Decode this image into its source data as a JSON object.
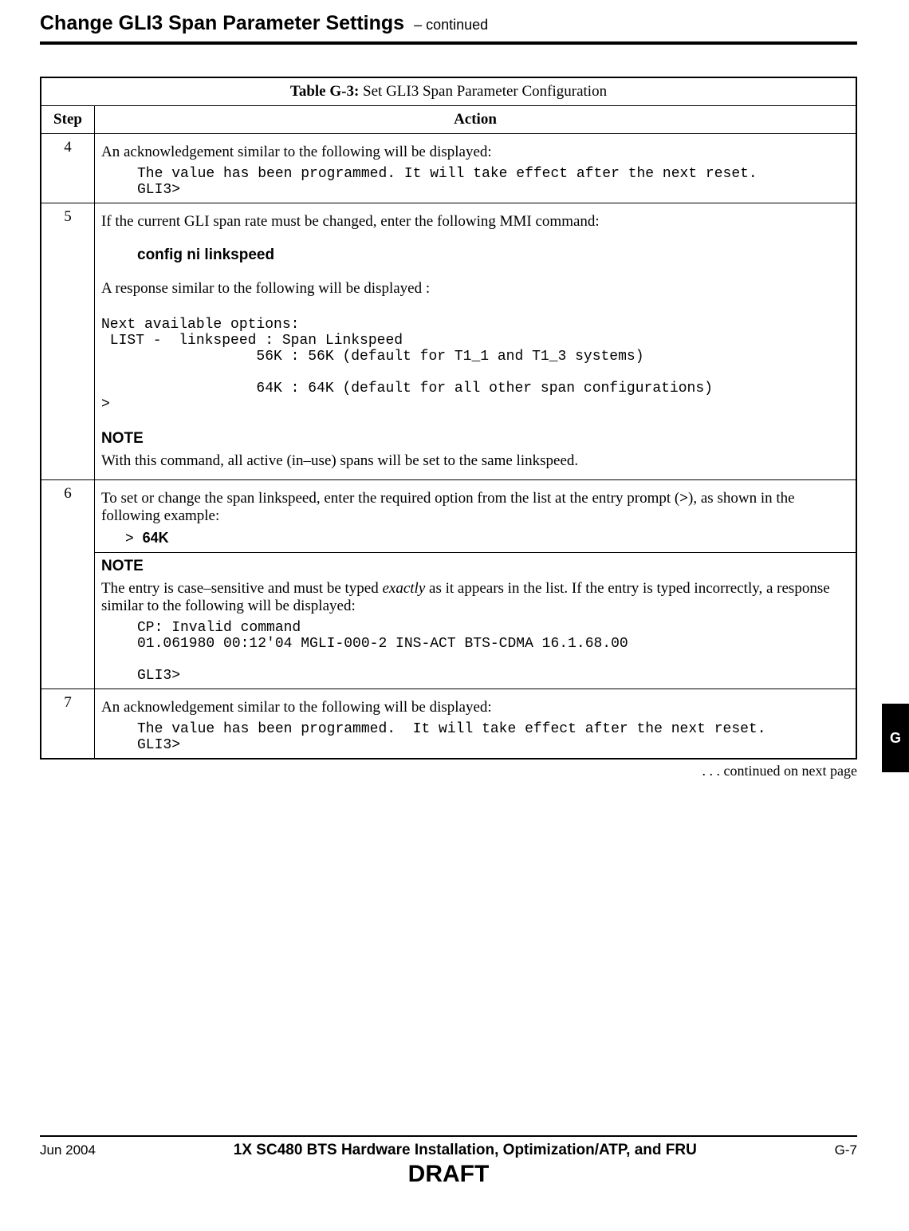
{
  "header": {
    "title": "Change GLI3 Span Parameter Settings",
    "continued": " – continued"
  },
  "table": {
    "caption_label": "Table G-3:",
    "caption_text": " Set GLI3 Span Parameter Configuration",
    "col_step": "Step",
    "col_action": "Action",
    "rows": {
      "r4": {
        "step": "4",
        "intro": "An acknowledgement similar to the following will be displayed:",
        "code": "The value has been programmed. It will take effect after the next reset.\nGLI3>"
      },
      "r5": {
        "step": "5",
        "intro": "If the current GLI span rate must be changed, enter the following MMI command:",
        "command": "config  ni  linkspeed",
        "response_intro": "A response similar to the following will be displayed :",
        "code": "Next available options:\n LIST -  linkspeed : Span Linkspeed\n                  56K : 56K (default for T1_1 and T1_3 systems)\n\n                  64K : 64K (default for all other span configurations)\n>",
        "note_label": "NOTE",
        "note_text": "With this command, all active (in–use) spans will be set to the same linkspeed."
      },
      "r6a": {
        "step": "6",
        "intro_pre": "To set or change the span linkspeed, enter the required option from the list at the entry prompt (",
        "intro_bold": ">",
        "intro_post": "), as shown in the following example:",
        "prompt_mono": "> ",
        "prompt_bold": "64K"
      },
      "r6b": {
        "note_label": "NOTE",
        "note_text_pre": "The entry is case–sensitive and must be typed ",
        "note_text_ital": "exactly",
        "note_text_post": " as it appears in the list. If the entry is typed incorrectly, a response similar to the following will be displayed:",
        "code": "CP: Invalid command\n01.061980 00:12'04 MGLI-000-2 INS-ACT BTS-CDMA 16.1.68.00\n\nGLI3>"
      },
      "r7": {
        "step": "7",
        "intro": "An acknowledgement similar to the following will be displayed:",
        "code": "The value has been programmed.  It will take effect after the next reset.\nGLI3>"
      }
    },
    "continued_note": " . . . continued on next page"
  },
  "side_tab": "G",
  "footer": {
    "date": "Jun 2004",
    "title": "1X SC480 BTS Hardware Installation, Optimization/ATP, and FRU",
    "page": "G-7",
    "draft": "DRAFT"
  }
}
